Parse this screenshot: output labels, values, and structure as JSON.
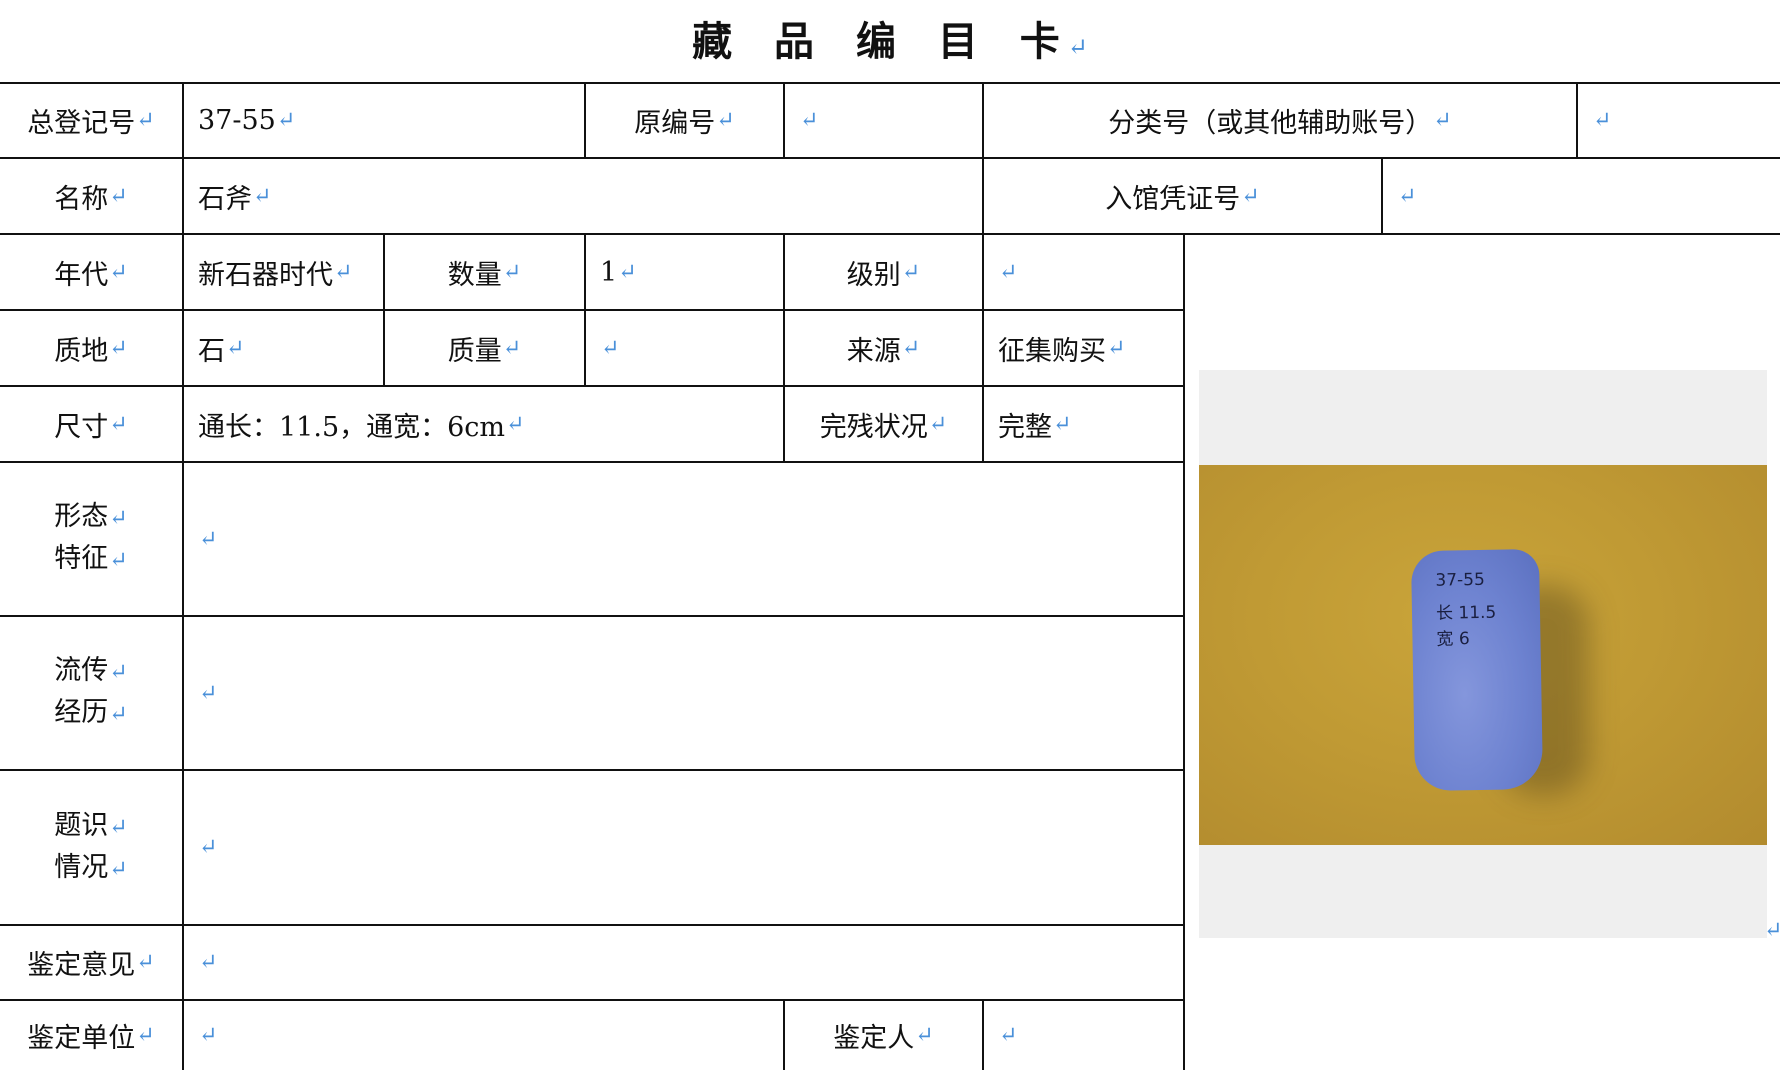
{
  "title": "藏 品 编 目 卡",
  "return_mark": "↵",
  "colors": {
    "return_mark": "#4a90d9",
    "rule": "#111111"
  },
  "labels": {
    "registration_no": "总登记号",
    "original_no": "原编号",
    "classification_no": "分类号（或其他辅助账号）",
    "name": "名称",
    "accession_voucher_no": "入馆凭证号",
    "era": "年代",
    "quantity": "数量",
    "grade": "级别",
    "material": "质地",
    "mass": "质量",
    "source": "来源",
    "dimensions": "尺寸",
    "condition": "完残状况",
    "shape_features": [
      "形态",
      "特征"
    ],
    "provenance": [
      "流传",
      "经历"
    ],
    "inscriptions": [
      "题识",
      "情况"
    ],
    "appraisal_opinion": "鉴定意见",
    "appraisal_unit": "鉴定单位",
    "appraiser": "鉴定人"
  },
  "values": {
    "registration_no": "37-55",
    "original_no": "",
    "classification_no": "",
    "name": "石斧",
    "accession_voucher_no": "",
    "era": "新石器时代",
    "quantity": "1",
    "grade": "",
    "material": "石",
    "mass": "",
    "source": "征集购买",
    "dimensions": "通长：11.5，通宽：6cm",
    "condition": "完整",
    "shape_features": "",
    "provenance": "",
    "inscriptions": "",
    "appraisal_opinion": "",
    "appraisal_unit": "",
    "appraiser": ""
  },
  "photo": {
    "subject": "stone-axe",
    "handwritten_marks": [
      "37-55",
      "长 11.5",
      "宽 6"
    ]
  }
}
